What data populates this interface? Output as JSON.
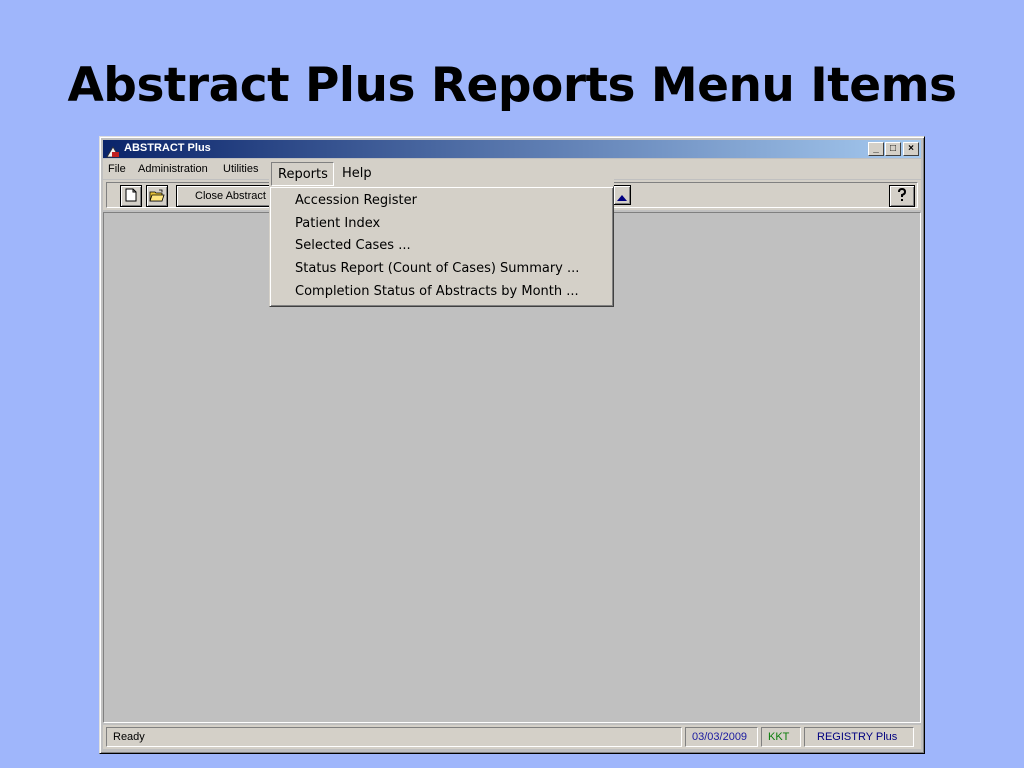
{
  "slide": {
    "title": "Abstract Plus Reports Menu Items"
  },
  "window": {
    "title": "ABSTRACT Plus",
    "buttons": {
      "minimize": "_",
      "maximize": "□",
      "close": "×"
    }
  },
  "menubar": {
    "items": [
      "File",
      "Administration",
      "Utilities",
      "Reports",
      "Help"
    ],
    "open": "Reports"
  },
  "toolbar": {
    "close_abstract_label": "Close Abstract",
    "icons": [
      "new-document-icon",
      "open-folder-icon",
      "scroll-up-icon",
      "help-icon"
    ]
  },
  "reports_menu": {
    "items": [
      "Accession Register",
      "Patient Index",
      "Selected Cases ...",
      "Status Report (Count of Cases) Summary ...",
      "Completion Status of Abstracts by Month ..."
    ]
  },
  "statusbar": {
    "status": "Ready",
    "date": "03/03/2009",
    "user": "KKT",
    "registry": "REGISTRY Plus",
    "colors": {
      "date": "#1a1aa0",
      "user": "#0b7d0b",
      "registry": "#000080"
    }
  }
}
